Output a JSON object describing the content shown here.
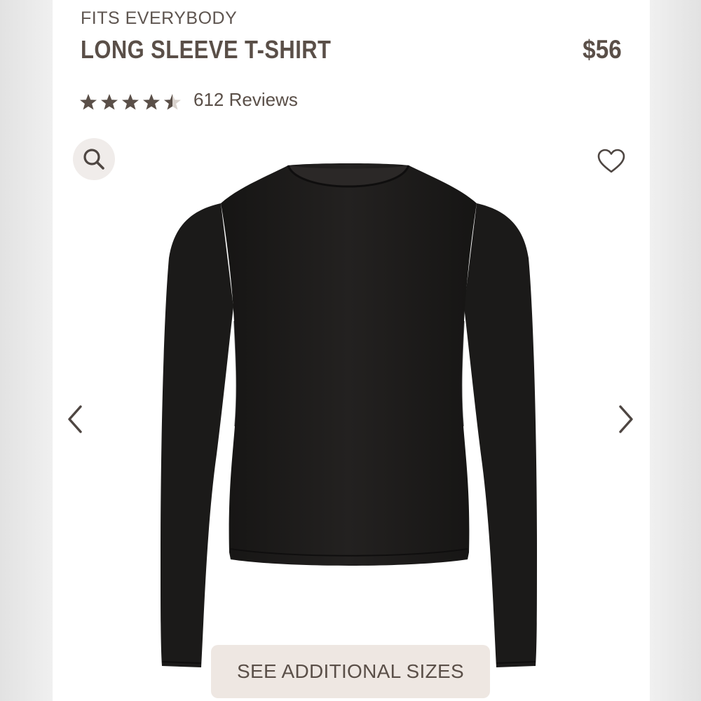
{
  "product": {
    "collection": "FITS EVERYBODY",
    "name": "LONG SLEEVE T-SHIRT",
    "price": "$56",
    "rating": 4.5,
    "rating_max": 5,
    "reviews_label": "612 Reviews"
  },
  "actions": {
    "sizes_label": "SEE ADDITIONAL SIZES"
  },
  "icons": {
    "search": "search-icon",
    "wishlist": "heart-outline-icon",
    "previous": "chevron-left-icon",
    "next": "chevron-right-icon",
    "rating": "star-icon"
  },
  "colors": {
    "text": "#5a4f48",
    "star": "#5a4f48",
    "button_bg": "#eee7e2",
    "product": "#1f1d1c"
  }
}
